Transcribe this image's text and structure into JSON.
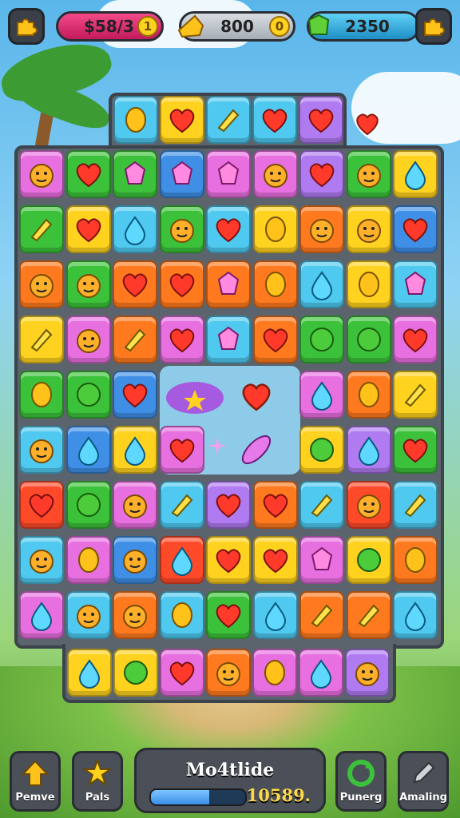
{
  "hud": {
    "left_currency": "$58/3",
    "left_coin": "1",
    "center_currency": "800",
    "center_coin": "0",
    "right_currency": "2350"
  },
  "bottom_bar": {
    "btn1": "Pemve",
    "btn2": "Pals",
    "center_title": "Mo4tlide",
    "score": "10589.",
    "progress": 0.62,
    "btn3": "Punerg",
    "btn4": "Amaling"
  },
  "tile_colors": {
    "pink": "#e86fe0",
    "green": "#3cc23a",
    "orange": "#ff7a1f",
    "yellow": "#ffd21f",
    "cyan": "#4fc9f0",
    "red": "#ff4a2a",
    "purple": "#b07af0",
    "blue": "#3f8fe6"
  }
}
